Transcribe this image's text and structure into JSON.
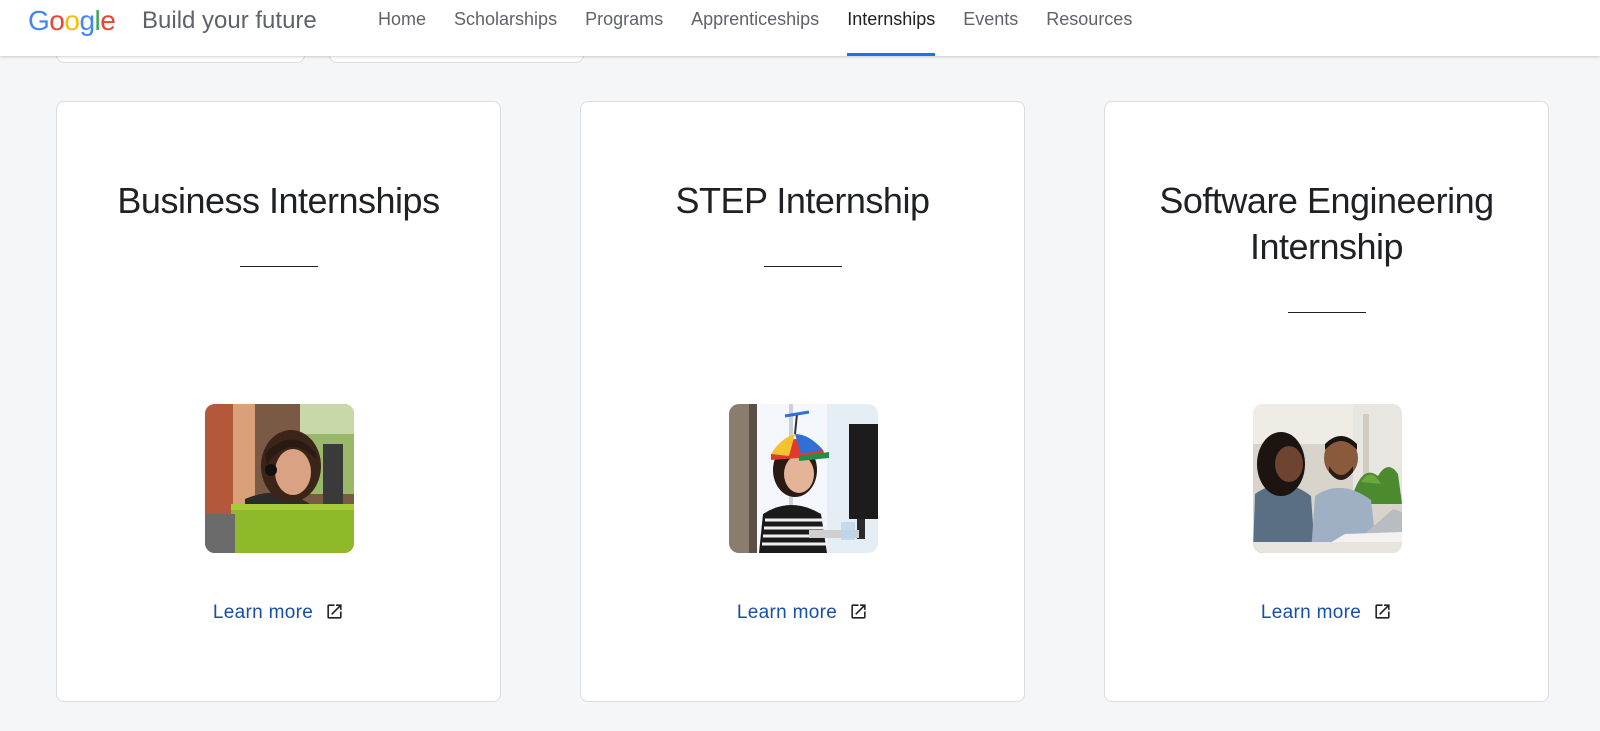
{
  "header": {
    "logo_text": "Google",
    "site_title": "Build your future",
    "nav": [
      {
        "label": "Home",
        "active": false
      },
      {
        "label": "Scholarships",
        "active": false
      },
      {
        "label": "Programs",
        "active": false
      },
      {
        "label": "Apprenticeships",
        "active": false
      },
      {
        "label": "Internships",
        "active": true
      },
      {
        "label": "Events",
        "active": false
      },
      {
        "label": "Resources",
        "active": false
      }
    ]
  },
  "cards": [
    {
      "title": "Business Internships",
      "image": "woman-with-headset-photo",
      "link_label": "Learn more",
      "link_icon": "open-in-new-icon"
    },
    {
      "title": "STEP Internship",
      "image": "intern-with-propeller-cap-photo",
      "link_label": "Learn more",
      "link_icon": "open-in-new-icon"
    },
    {
      "title": "Software Engineering Internship",
      "image": "two-people-at-laptop-photo",
      "link_label": "Learn more",
      "link_icon": "open-in-new-icon"
    }
  ],
  "colors": {
    "accent": "#1a73e8",
    "link": "#174ea6",
    "background": "#f5f6f8",
    "google_blue": "#4285f4",
    "google_red": "#ea4335",
    "google_yellow": "#fbbc05",
    "google_green": "#34a853"
  }
}
